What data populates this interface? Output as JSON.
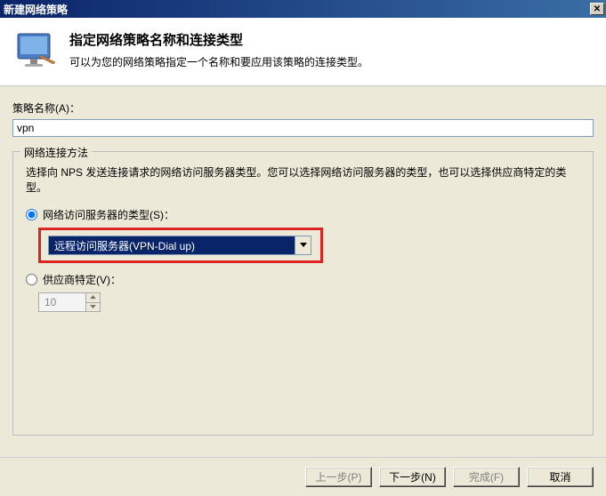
{
  "window": {
    "title": "新建网络策略"
  },
  "header": {
    "title": "指定网络策略名称和连接类型",
    "subtitle": "可以为您的网络策略指定一个名称和要应用该策略的连接类型。"
  },
  "policy": {
    "name_label": "策略名称(A)：",
    "name_value": "vpn"
  },
  "group": {
    "title": "网络连接方法",
    "description": "选择向 NPS 发送连接请求的网络访问服务器类型。您可以选择网络访问服务器的类型，也可以选择供应商特定的类型。",
    "radio_server_type": "网络访问服务器的类型(S)：",
    "server_type_value": "远程访问服务器(VPN-Dial up)",
    "radio_vendor": "供应商特定(V)：",
    "vendor_value": "10"
  },
  "buttons": {
    "back": "上一步(P)",
    "next": "下一步(N)",
    "finish": "完成(F)",
    "cancel": "取消"
  }
}
